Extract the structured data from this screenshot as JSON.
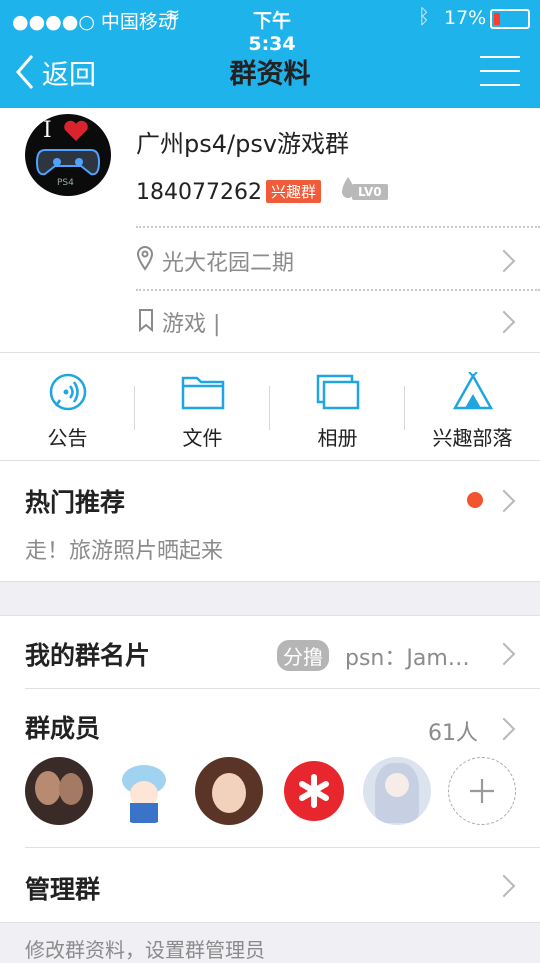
{
  "status_bar": {
    "carrier": "●●●●○ 中国移动",
    "time": "下午5:34",
    "battery": "17%"
  },
  "nav": {
    "back_label": "返回",
    "title": "群资料"
  },
  "group": {
    "name": "广州ps4/psv游戏群",
    "id": "184077262",
    "tag": "兴趣群",
    "level": "LV0",
    "location": "光大花园二期",
    "category": "游戏 |"
  },
  "avatar_text": {
    "top": "I",
    "bottom": "PS4"
  },
  "quick_actions": [
    {
      "label": "公告"
    },
    {
      "label": "文件"
    },
    {
      "label": "相册"
    },
    {
      "label": "兴趣部落"
    }
  ],
  "recommend": {
    "title": "热门推荐",
    "subtitle": "走！旅游照片晒起来"
  },
  "card": {
    "title": "我的群名片",
    "tag": "分撸",
    "value": "psn：Jam…"
  },
  "members": {
    "title": "群成员",
    "count": "61人"
  },
  "manage": {
    "title": "管理群",
    "hint": "修改群资料，设置群管理员"
  },
  "colors": {
    "nav_bg": "#1fb3ec",
    "tag_bg": "#f05b3a",
    "dot": "#f1542e",
    "icon": "#1fa6e0"
  }
}
